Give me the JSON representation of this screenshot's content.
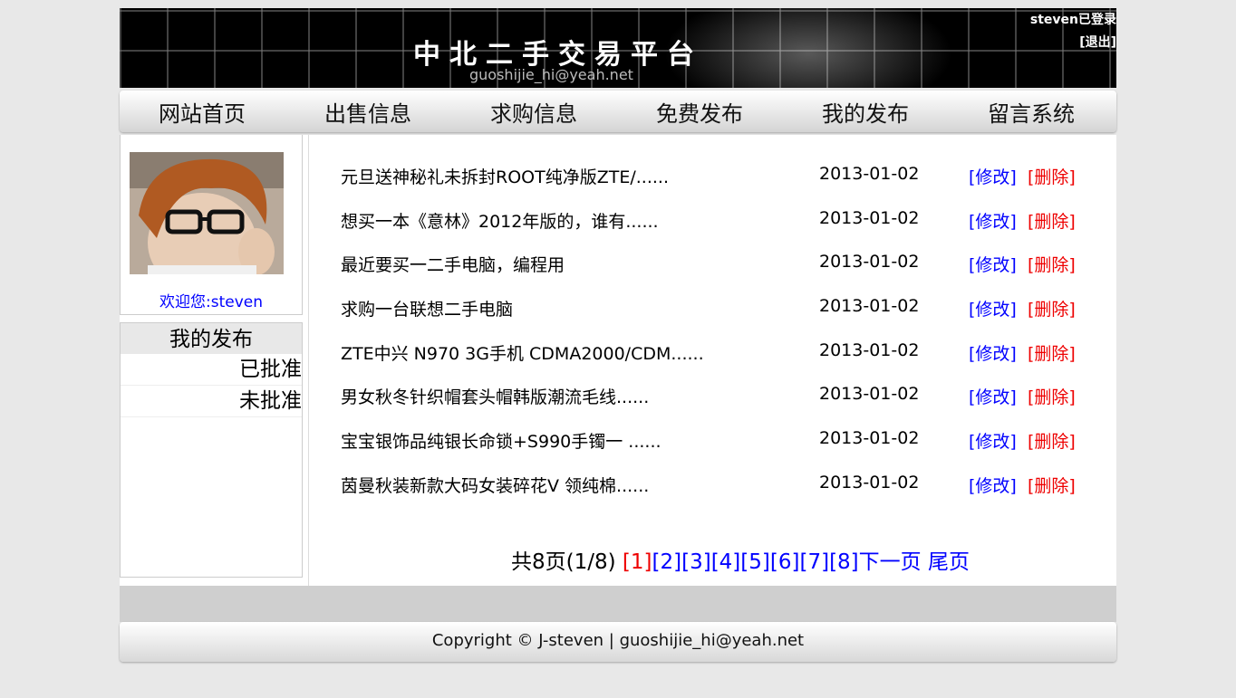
{
  "header": {
    "title": "中北二手交易平台",
    "email": "guoshijie_hi@yeah.net",
    "login_status": "steven已登录",
    "logout": "[退出]"
  },
  "nav": {
    "items": [
      "网站首页",
      "出售信息",
      "求购信息",
      "免费发布",
      "我的发布",
      "留言系统"
    ]
  },
  "sidebar": {
    "welcome": "欢迎您:steven",
    "menu_title": "我的发布",
    "menu_items": [
      "已批准",
      "未批准"
    ]
  },
  "posts": [
    {
      "title": "元旦送神秘礼未拆封ROOT纯净版ZTE/......",
      "date": "2013-01-02",
      "edit": "[修改]",
      "delete": "[删除]"
    },
    {
      "title": "想买一本《意林》2012年版的，谁有......",
      "date": "2013-01-02",
      "edit": "[修改]",
      "delete": "[删除]"
    },
    {
      "title": "最近要买一二手电脑，编程用",
      "date": "2013-01-02",
      "edit": "[修改]",
      "delete": "[删除]"
    },
    {
      "title": "求购一台联想二手电脑",
      "date": "2013-01-02",
      "edit": "[修改]",
      "delete": "[删除]"
    },
    {
      "title": "ZTE中兴 N970 3G手机 CDMA2000/CDM......",
      "date": "2013-01-02",
      "edit": "[修改]",
      "delete": "[删除]"
    },
    {
      "title": "男女秋冬针织帽套头帽韩版潮流毛线......",
      "date": "2013-01-02",
      "edit": "[修改]",
      "delete": "[删除]"
    },
    {
      "title": "宝宝银饰品纯银长命锁+S990手镯一 ......",
      "date": "2013-01-02",
      "edit": "[修改]",
      "delete": "[删除]"
    },
    {
      "title": "茵曼秋装新款大码女装碎花V 领纯棉......",
      "date": "2013-01-02",
      "edit": "[修改]",
      "delete": "[删除]"
    }
  ],
  "pagination": {
    "summary": "共8页(1/8)",
    "current": "[1]",
    "pages": [
      "[2]",
      "[3]",
      "[4]",
      "[5]",
      "[6]",
      "[7]",
      "[8]"
    ],
    "next": "下一页",
    "last": "尾页"
  },
  "footer": {
    "text": "Copyright © J-steven | guoshijie_hi@yeah.net"
  },
  "colors": {
    "link": "#0000ff",
    "delete": "#ee0000",
    "current_page": "#ee0000"
  }
}
